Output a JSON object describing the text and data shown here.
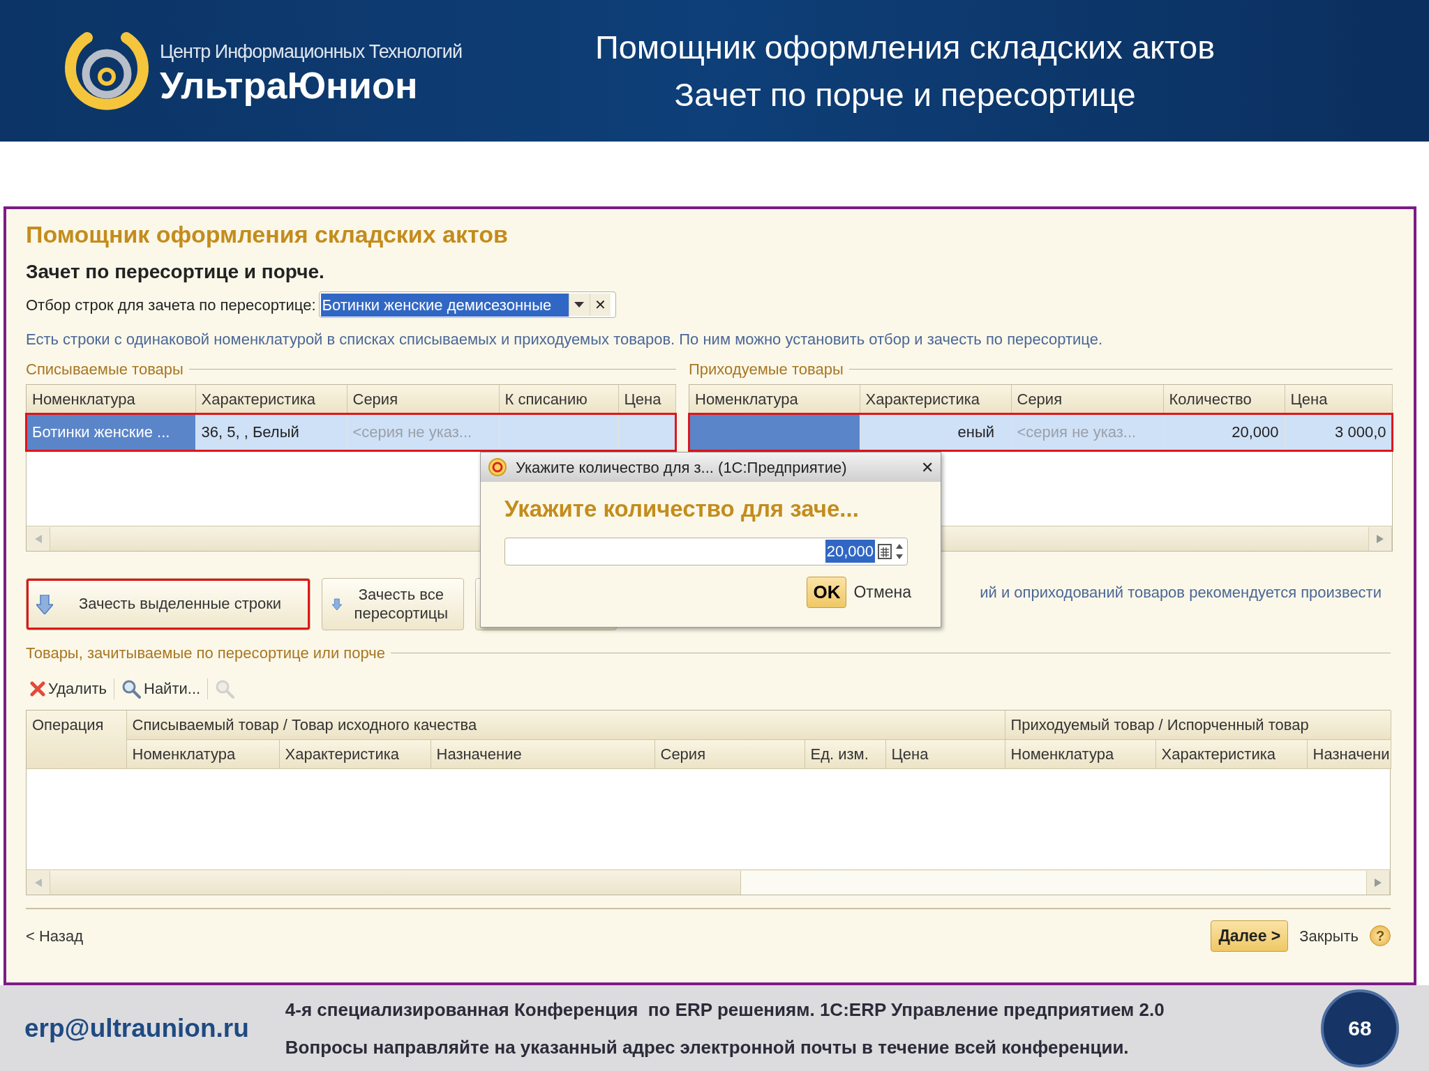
{
  "slide_header": {
    "logo": {
      "tagline": "Центр Информационных Технологий",
      "brand": "УльтраЮнион"
    },
    "title_lines": [
      "Помощник оформления складских актов",
      "Зачет по порче и пересортице"
    ]
  },
  "window": {
    "title": "Помощник оформления складских актов",
    "subtitle": "Зачет по пересортице и порче.",
    "filter": {
      "label": "Отбор строк для зачета по пересортице:",
      "value": "Ботинки женские демисезонные",
      "clear_glyph": "✕"
    },
    "info": "Есть строки с одинаковой номенклатурой в списках списываемых и приходуемых товаров. По ним можно установить отбор и зачесть по пересортице.",
    "writeoff": {
      "title": "Списываемые товары",
      "columns": [
        "Номенклатура",
        "Характеристика",
        "Серия",
        "К списанию",
        "Цена"
      ],
      "rows": [
        {
          "selected": true,
          "highlighted": true,
          "cells": [
            {
              "text": "Ботинки женские ...",
              "muted": false
            },
            {
              "text": "36, 5, , Белый",
              "muted": false
            },
            {
              "text": "<серия не указ...",
              "muted": true
            },
            {
              "text": null
            },
            {
              "text": null
            }
          ]
        }
      ]
    },
    "receipt": {
      "title": "Приходуемые товары",
      "columns": [
        "Номенклатура",
        "Характеристика",
        "Серия",
        "Количество",
        "Цена"
      ],
      "rows": [
        {
          "selected": true,
          "highlighted": true,
          "cells": [
            {
              "text": null
            },
            {
              "text": "еный",
              "muted": false
            },
            {
              "text": "<серия не указ...",
              "muted": true
            },
            {
              "text": "20,000",
              "muted": false
            },
            {
              "text": "3 000,0",
              "muted": false
            }
          ]
        }
      ]
    },
    "actions": [
      {
        "label": "Зачесть выделенные строки",
        "icon": true,
        "highlighted": true
      },
      {
        "label": "Зачесть все пересортицы",
        "icon": true,
        "highlighted": false
      },
      {
        "highlighted": false
      }
    ],
    "note": "ий и оприходований товаров рекомендуется произвести",
    "credit_section": {
      "title": "Товары, зачитываемые по пересортице или порче",
      "toolbar": [
        {
          "kind": "delete",
          "label": "Удалить",
          "disabled": false
        },
        {
          "kind": "find",
          "label": "Найти...",
          "disabled": false
        },
        {
          "kind": "find",
          "disabled": true
        }
      ],
      "header_groups": [
        {
          "label": "Операция"
        },
        {
          "label": "Списываемый товар / Товар исходного качества",
          "columns": [
            "Номенклатура",
            "Характеристика",
            "Назначение",
            "Серия",
            "Ед. изм.",
            "Цена"
          ]
        },
        {
          "label": "Приходуемый товар / Испорченный товар",
          "columns": [
            "Номенклатура",
            "Характеристика",
            "Назначени"
          ]
        }
      ]
    },
    "back": "< Назад",
    "next": "Далее >",
    "close": "Закрыть",
    "help_glyph": "?",
    "dialog": {
      "title": "Укажите количество для з... (1С:Предприятие)",
      "close_glyph": "✕",
      "heading": "Укажите количество для заче...",
      "quantity": "20,000",
      "buttons": [
        {
          "label": "OK",
          "default": true
        },
        {
          "label": "Отмена",
          "default": false
        }
      ]
    }
  },
  "slide_footer": {
    "email": "erp@ultraunion.ru",
    "lines": [
      "4-я специализированная Конференция  по ERP решениям. 1С:ERP Управление предприятием 2.0",
      "Вопросы направляйте на указанный адрес электронной почты в течение всей конференции."
    ],
    "page_number": "68"
  }
}
